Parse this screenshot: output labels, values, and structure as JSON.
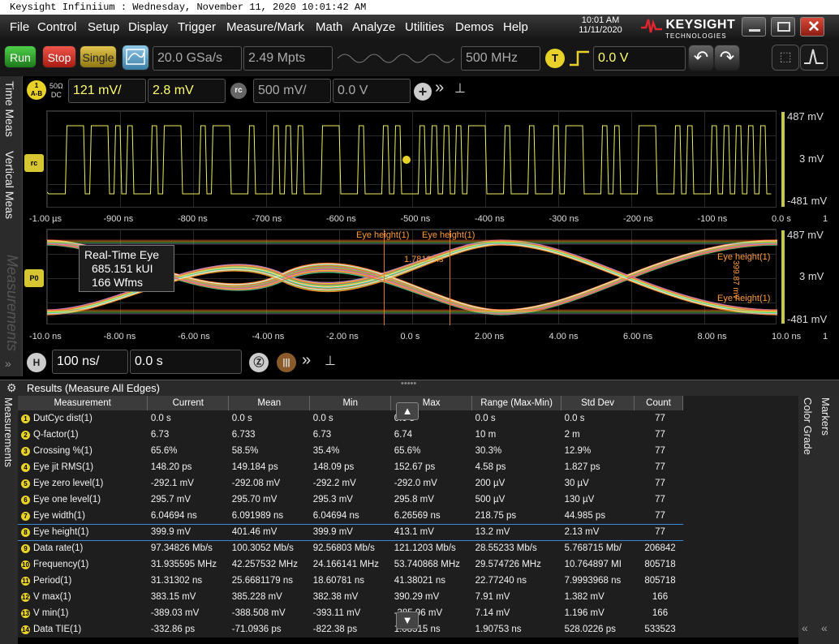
{
  "titlebar": {
    "text": "Keysight Infiniium : Wednesday, November 11, 2020 10:01:42 AM"
  },
  "menu": [
    "File",
    "Control",
    "Setup",
    "Display",
    "Trigger",
    "Measure/Mark",
    "Math",
    "Analyze",
    "Utilities",
    "Demos",
    "Help"
  ],
  "clock": {
    "time": "10:01 AM",
    "date": "11/11/2020"
  },
  "logo": {
    "name": "KEYSIGHT",
    "sub": "TECHNOLOGIES"
  },
  "toolbar": {
    "run": "Run",
    "stop": "Stop",
    "single": "Single",
    "sample_rate": "20.0 GSa/s",
    "memory_depth": "2.49 Mpts",
    "bandwidth": "500 MHz",
    "trigger_badge": "T",
    "trigger_level": "0.0 V"
  },
  "channel": {
    "badge": "1",
    "badge_sub": "A-B",
    "impedance": "50Ω",
    "coupling": "DC",
    "scale": "121 mV/",
    "offset": "2.8 mV",
    "rc_badge": "rc",
    "rc_scale": "500 mV/",
    "rc_offset": "0.0 V"
  },
  "left_tabs": {
    "time_meas": "Time Meas",
    "vertical_meas": "Vertical Meas",
    "measurements": "Measurements"
  },
  "upper_plot": {
    "y_top": "487 mV",
    "y_mid": "3 mV",
    "y_bot": "-481 mV",
    "marker": "rc",
    "x_labels": [
      "-1.00 µs",
      "-900 ns",
      "-800 ns",
      "-700 ns",
      "-600 ns",
      "-500 ns",
      "-400 ns",
      "-300 ns",
      "-200 ns",
      "-100 ns",
      "0.0 s"
    ],
    "x_edge": "1"
  },
  "eye_plot": {
    "y_top": "487 mV",
    "y_mid": "3 mV",
    "y_bot": "-481 mV",
    "marker": "P0",
    "box_title": "Real-Time Eye",
    "box_ui": "685.151 kUI",
    "box_wfms": "166 Wfms",
    "annot_height1": "Eye height(1)",
    "annot_height2": "Eye height(1)",
    "annot_ns": "1.7813 ns",
    "annot_right": "Eye height(1)",
    "annot_right2": "Eye height(1)",
    "annot_vert": "399.87 mV",
    "x_labels": [
      "-10.0 ns",
      "-8.00 ns",
      "-6.00 ns",
      "-4.00 ns",
      "-2.00 ns",
      "0.0 s",
      "2.00 ns",
      "4.00 ns",
      "6.00 ns",
      "8.00 ns",
      "10.0 ns"
    ],
    "x_edge": "1"
  },
  "horizontal": {
    "badge": "H",
    "scale": "100 ns/",
    "position": "0.0 s"
  },
  "results": {
    "header": "Results (Measure All Edges)",
    "columns": [
      "Measurement",
      "Current",
      "Mean",
      "Min",
      "Max",
      "Range (Max-Min)",
      "Std Dev",
      "Count"
    ],
    "rows": [
      [
        "DutCyc dist(1)",
        "0.0 s",
        "0.0 s",
        "0.0 s",
        "0.0 s",
        "0.0 s",
        "0.0 s",
        "77"
      ],
      [
        "Q-factor(1)",
        "6.73",
        "6.733",
        "6.73",
        "6.74",
        "10 m",
        "2 m",
        "77"
      ],
      [
        "Crossing %(1)",
        "65.6%",
        "58.5%",
        "35.4%",
        "65.6%",
        "30.3%",
        "12.9%",
        "77"
      ],
      [
        "Eye jit RMS(1)",
        "148.20 ps",
        "149.184 ps",
        "148.09 ps",
        "152.67 ps",
        "4.58 ps",
        "1.827 ps",
        "77"
      ],
      [
        "Eye zero level(1)",
        "-292.1 mV",
        "-292.08 mV",
        "-292.2 mV",
        "-292.0 mV",
        "200 µV",
        "30 µV",
        "77"
      ],
      [
        "Eye one level(1)",
        "295.7 mV",
        "295.70 mV",
        "295.3 mV",
        "295.8 mV",
        "500 µV",
        "130 µV",
        "77"
      ],
      [
        "Eye width(1)",
        "6.04694 ns",
        "6.091989 ns",
        "6.04694 ns",
        "6.26569 ns",
        "218.75 ps",
        "44.985 ps",
        "77"
      ],
      [
        "Eye height(1)",
        "399.9 mV",
        "401.46 mV",
        "399.9 mV",
        "413.1 mV",
        "13.2 mV",
        "2.13 mV",
        "77"
      ],
      [
        "Data rate(1)",
        "97.34826 Mb/s",
        "100.3052 Mb/s",
        "92.56803 Mb/s",
        "121.1203 Mb/s",
        "28.55233 Mb/s",
        "5.768715 Mb/",
        "206842"
      ],
      [
        "Frequency(1)",
        "31.935595 MHz",
        "42.257532 MHz",
        "24.166141 MHz",
        "53.740868 MHz",
        "29.574726 MHz",
        "10.764897 MI",
        "805718"
      ],
      [
        "Period(1)",
        "31.31302 ns",
        "25.6681179 ns",
        "18.60781 ns",
        "41.38021 ns",
        "22.77240 ns",
        "7.9993968 ns",
        "805718"
      ],
      [
        "V max(1)",
        "383.15 mV",
        "385.228 mV",
        "382.38 mV",
        "390.29 mV",
        "7.91 mV",
        "1.382 mV",
        "166"
      ],
      [
        "V min(1)",
        "-389.03 mV",
        "-388.508 mV",
        "-393.11 mV",
        "-385.96 mV",
        "7.14 mV",
        "1.196 mV",
        "166"
      ],
      [
        "Data TIE(1)",
        "-332.86 ps",
        "-71.0936 ps",
        "-822.38 ps",
        "1.08515 ns",
        "1.90753 ns",
        "528.0226 ps",
        "533523"
      ]
    ],
    "selected_row": 7
  },
  "right_tabs": {
    "markers": "Markers",
    "color_grade": "Color Grade"
  },
  "left_results_tab": "Measurements"
}
